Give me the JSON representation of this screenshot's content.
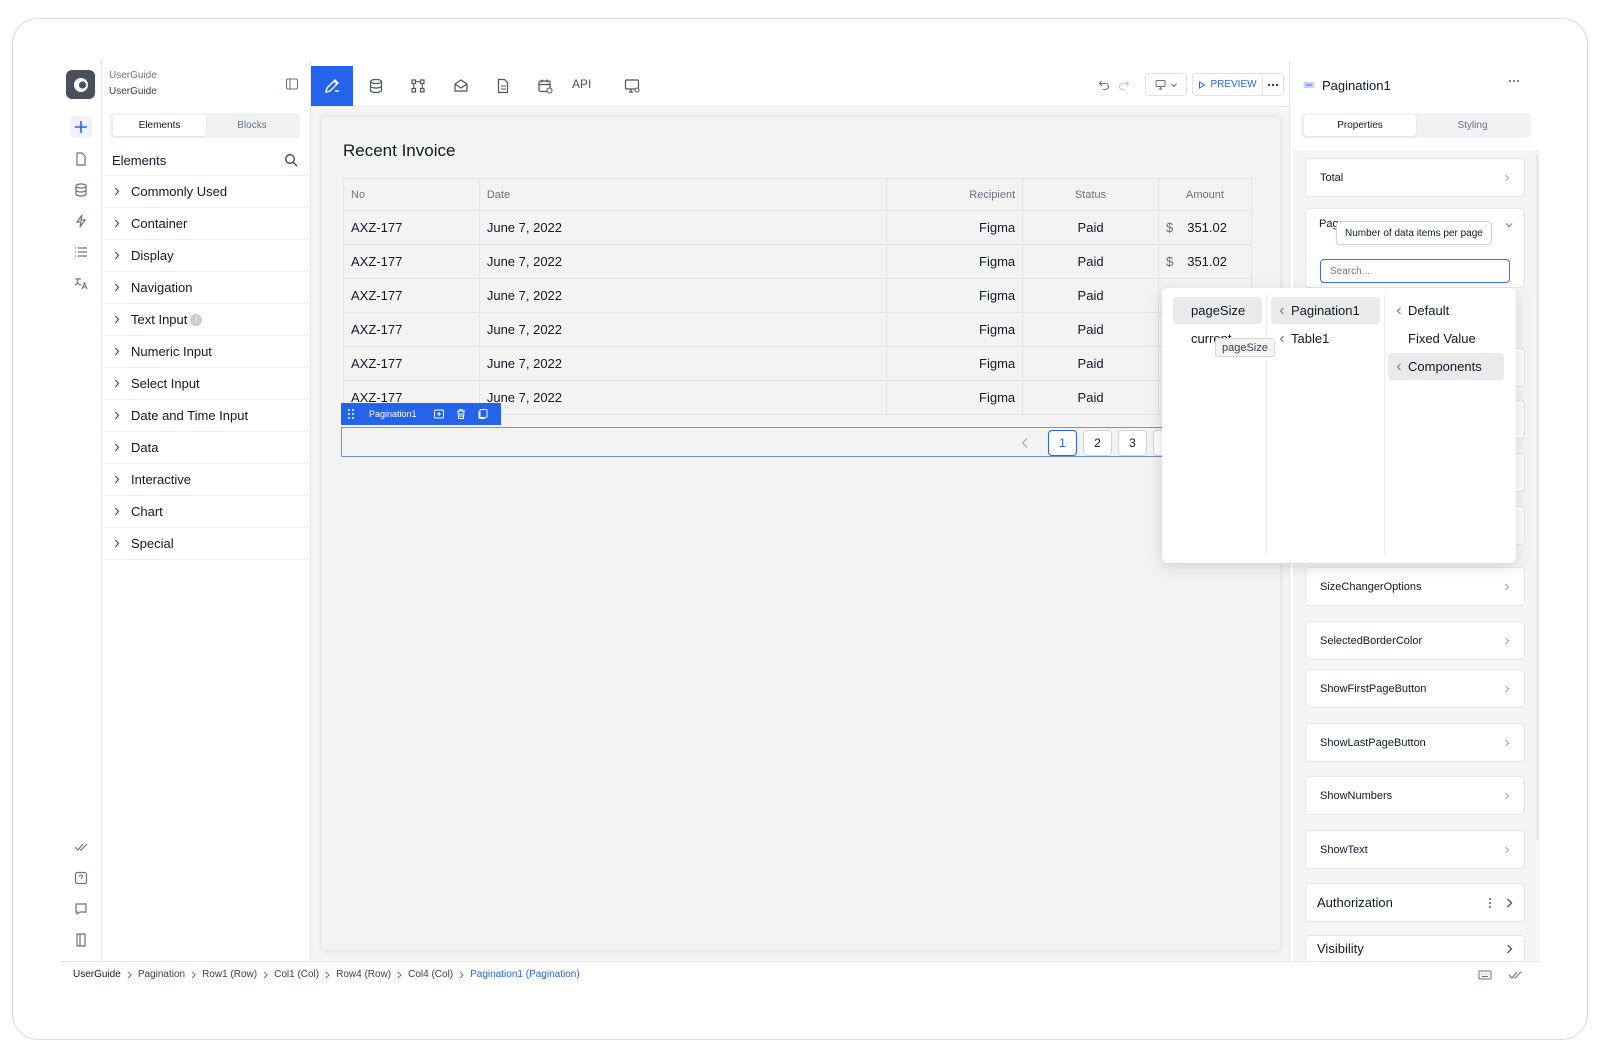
{
  "app": {
    "name": "UserGuide",
    "subtitle": "UserGuide"
  },
  "sidebar": {
    "tabs": [
      "Elements",
      "Blocks"
    ],
    "heading": "Elements",
    "categories": [
      {
        "label": "Commonly Used"
      },
      {
        "label": "Container"
      },
      {
        "label": "Display"
      },
      {
        "label": "Navigation"
      },
      {
        "label": "Text Input",
        "info": true
      },
      {
        "label": "Numeric Input"
      },
      {
        "label": "Select Input"
      },
      {
        "label": "Date and Time Input"
      },
      {
        "label": "Data"
      },
      {
        "label": "Interactive"
      },
      {
        "label": "Chart"
      },
      {
        "label": "Special"
      }
    ]
  },
  "toolbar": {
    "icons": [
      "edit-icon",
      "database-icon",
      "flow-icon",
      "mail-icon",
      "document-icon",
      "calendar-icon",
      "api",
      "monitor-settings-icon"
    ],
    "api_label": "API",
    "preview_label": "PREVIEW"
  },
  "canvas": {
    "title": "Recent Invoice",
    "table": {
      "columns": [
        "No",
        "Date",
        "Recipient",
        "Status",
        "Amount"
      ],
      "rows": [
        [
          "AXZ-177",
          "June 7, 2022",
          "Figma",
          "Paid",
          "351.02"
        ],
        [
          "AXZ-177",
          "June 7, 2022",
          "Figma",
          "Paid",
          "351.02"
        ],
        [
          "AXZ-177",
          "June 7, 2022",
          "Figma",
          "Paid",
          ""
        ],
        [
          "AXZ-177",
          "June 7, 2022",
          "Figma",
          "Paid",
          ""
        ],
        [
          "AXZ-177",
          "June 7, 2022",
          "Figma",
          "Paid",
          ""
        ],
        [
          "AXZ-177",
          "June 7, 2022",
          "Figma",
          "Paid",
          ""
        ]
      ],
      "currency": "$"
    },
    "selected_component": "Pagination1",
    "pages": [
      "1",
      "2",
      "3"
    ],
    "current_page": "1"
  },
  "popup": {
    "col1": [
      "pageSize",
      "current"
    ],
    "col1_selected": "pageSize",
    "col2": [
      "Pagination1",
      "Table1"
    ],
    "col2_selected": "Pagination1",
    "col3": [
      "Default",
      "Fixed Value",
      "Components"
    ],
    "col3_selected": "Components",
    "hover_tip": "pageSize"
  },
  "panel": {
    "title": "Pagination1",
    "tabs": [
      "Properties",
      "Styling"
    ],
    "active_tab": "Properties",
    "total_label": "Total",
    "page_size_label": "Pag",
    "tooltip": "Number of data items per page",
    "search_placeholder": "Search...",
    "props": [
      "SizeChangerOptions",
      "SelectedBorderColor",
      "ShowFirstPageButton",
      "ShowLastPageButton",
      "ShowNumbers",
      "ShowText"
    ],
    "sections": [
      "Authorization",
      "Visibility"
    ]
  },
  "breadcrumb": [
    "UserGuide",
    "Pagination",
    "Row1 (Row)",
    "Col1 (Col)",
    "Row4 (Row)",
    "Col4 (Col)",
    "Pagination1 (Pagination)"
  ]
}
